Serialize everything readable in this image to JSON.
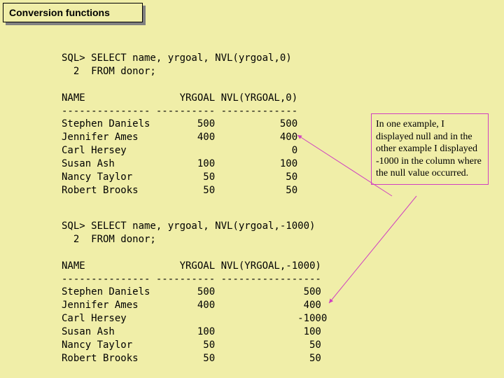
{
  "title": "Conversion functions",
  "callout": "In one example, I displayed null and in the other example I displayed -1000 in the column where the null value occurred.",
  "sql1": {
    "prompt1": "SQL> SELECT name, yrgoal, NVL(yrgoal,0)",
    "prompt2": "  2  FROM donor;",
    "head": "NAME                YRGOAL NVL(YRGOAL,0)",
    "rule": "--------------- ---------- -------------",
    "rows": [
      "Stephen Daniels        500           500",
      "Jennifer Ames          400           400",
      "Carl Hersey                            0",
      "Susan Ash              100           100",
      "Nancy Taylor            50            50",
      "Robert Brooks           50            50"
    ]
  },
  "sql2": {
    "prompt1": "SQL> SELECT name, yrgoal, NVL(yrgoal,-1000)",
    "prompt2": "  2  FROM donor;",
    "head": "NAME                YRGOAL NVL(YRGOAL,-1000)",
    "rule": "--------------- ---------- -----------------",
    "rows": [
      "Stephen Daniels        500               500",
      "Jennifer Ames          400               400",
      "Carl Hersey                             -1000",
      "Susan Ash              100               100",
      "Nancy Taylor            50                50",
      "Robert Brooks           50                50"
    ]
  }
}
